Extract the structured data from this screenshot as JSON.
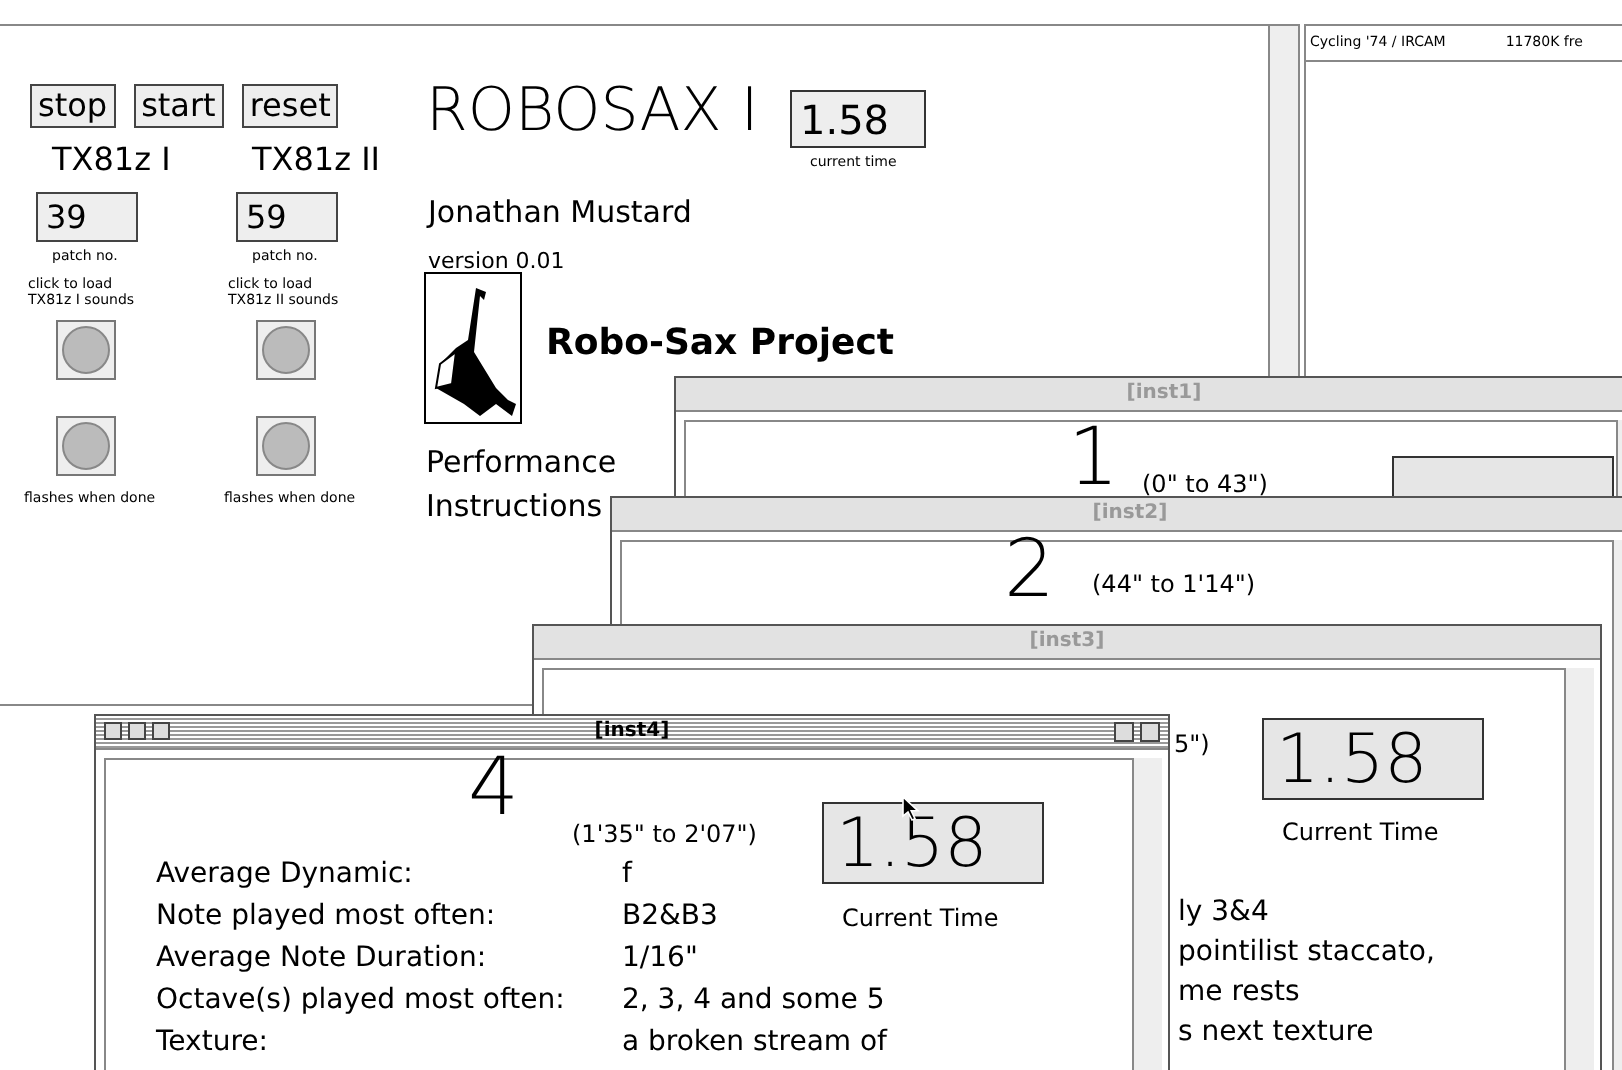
{
  "main_patch": {
    "buttons": [
      "stop",
      "start",
      "reset"
    ],
    "synths": [
      {
        "name": "TX81z I",
        "patch": "39",
        "patch_label": "patch no.",
        "load_label": [
          "click to load",
          "TX81z I sounds"
        ],
        "done_label": "flashes when done"
      },
      {
        "name": "TX81z II",
        "patch": "59",
        "patch_label": "patch no.",
        "load_label": [
          "click to load",
          "TX81z II sounds"
        ],
        "done_label": "flashes when done"
      }
    ],
    "title": "ROBOSAX I",
    "time": "1.58",
    "time_label": "current time",
    "author": "Jonathan Mustard",
    "version": "version 0.01",
    "project": "Robo-Sax Project",
    "instructions": [
      "Performance",
      "Instructions"
    ]
  },
  "console": {
    "header": "Cycling '74 / IRCAM",
    "memory": "11780K fre"
  },
  "windows": [
    {
      "title": "[inst1]",
      "active": false,
      "number": "1",
      "range": "(0\" to 43\")",
      "time_display": true
    },
    {
      "title": "[inst2]",
      "active": false,
      "number": "2",
      "range": "(44\" to 1'14\")"
    },
    {
      "title": "[inst3]",
      "active": false,
      "range": "5\")",
      "time": "1.58",
      "time_label": "Current Time",
      "lines": [
        "ly 3&4",
        "pointilist staccato,",
        "me rests",
        "s next texture"
      ]
    },
    {
      "title": "[inst4]",
      "active": true,
      "number": "4",
      "range": "(1'35\" to 2'07\")",
      "time": "1.58",
      "time_label": "Current Time",
      "rows": [
        {
          "label": "Average Dynamic:",
          "value": "f"
        },
        {
          "label": "Note played most often:",
          "value": "B2&B3"
        },
        {
          "label": "Average Note Duration:",
          "value": "1/16\""
        },
        {
          "label": "Octave(s) played most often:",
          "value": "2, 3, 4 and some 5"
        },
        {
          "label": "Texture:",
          "value": "a broken stream of"
        }
      ]
    }
  ]
}
